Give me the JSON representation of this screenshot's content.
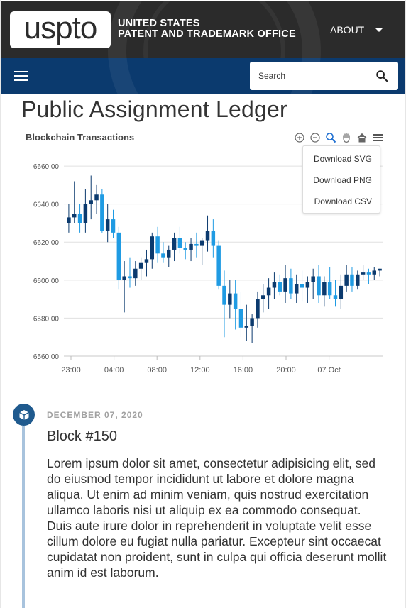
{
  "header": {
    "logo_text": "uspto",
    "agency_line1": "UNITED STATES",
    "agency_line2": "PATENT AND TRADEMARK OFFICE",
    "about_label": "ABOUT"
  },
  "search": {
    "placeholder": "Search"
  },
  "page": {
    "title": "Public Assignment Ledger"
  },
  "chart_menu": {
    "items": [
      "Download SVG",
      "Download PNG",
      "Download CSV"
    ]
  },
  "chart_data": {
    "type": "candlestick",
    "title": "Blockchain Transactions",
    "xlabel": "",
    "ylabel": "",
    "ylim": [
      6560,
      6666
    ],
    "yticks": [
      "6660.00",
      "6640.00",
      "6620.00",
      "6600.00",
      "6580.00",
      "6560.00"
    ],
    "xticks": [
      "23:00",
      "04:00",
      "08:00",
      "12:00",
      "16:00",
      "20:00",
      "07 Oct"
    ],
    "grid": true,
    "colors": {
      "up": "#0b3a6e",
      "down": "#1f9be3",
      "grid": "#e0e0e0",
      "axis": "#555555"
    },
    "candles": [
      [
        6630,
        6640,
        6625,
        6633
      ],
      [
        6633,
        6652,
        6630,
        6635
      ],
      [
        6635,
        6640,
        6625,
        6630
      ],
      [
        6630,
        6648,
        6625,
        6640
      ],
      [
        6640,
        6655,
        6632,
        6642
      ],
      [
        6642,
        6650,
        6635,
        6645
      ],
      [
        6645,
        6648,
        6625,
        6626
      ],
      [
        6626,
        6640,
        6620,
        6632
      ],
      [
        6632,
        6637,
        6622,
        6625
      ],
      [
        6625,
        6628,
        6595,
        6600
      ],
      [
        6600,
        6610,
        6583,
        6602
      ],
      [
        6602,
        6612,
        6596,
        6601
      ],
      [
        6601,
        6610,
        6597,
        6606
      ],
      [
        6606,
        6612,
        6600,
        6609
      ],
      [
        6609,
        6616,
        6602,
        6611
      ],
      [
        6611,
        6625,
        6606,
        6623
      ],
      [
        6623,
        6628,
        6609,
        6614
      ],
      [
        6614,
        6620,
        6609,
        6612
      ],
      [
        6612,
        6618,
        6607,
        6616
      ],
      [
        6616,
        6625,
        6610,
        6622
      ],
      [
        6622,
        6628,
        6614,
        6617
      ],
      [
        6617,
        6620,
        6611,
        6616
      ],
      [
        6616,
        6622,
        6610,
        6619
      ],
      [
        6619,
        6625,
        6612,
        6618
      ],
      [
        6618,
        6622,
        6608,
        6621
      ],
      [
        6621,
        6634,
        6615,
        6626
      ],
      [
        6626,
        6632,
        6612,
        6618
      ],
      [
        6618,
        6621,
        6595,
        6597
      ],
      [
        6597,
        6605,
        6570,
        6587
      ],
      [
        6587,
        6600,
        6580,
        6593
      ],
      [
        6593,
        6600,
        6574,
        6585
      ],
      [
        6585,
        6594,
        6570,
        6575
      ],
      [
        6575,
        6587,
        6568,
        6576
      ],
      [
        6576,
        6582,
        6567,
        6580
      ],
      [
        6580,
        6594,
        6575,
        6590
      ],
      [
        6590,
        6598,
        6583,
        6592
      ],
      [
        6592,
        6601,
        6585,
        6596
      ],
      [
        6596,
        6604,
        6590,
        6599
      ],
      [
        6599,
        6603,
        6592,
        6594
      ],
      [
        6594,
        6608,
        6588,
        6601
      ],
      [
        6601,
        6606,
        6590,
        6593
      ],
      [
        6593,
        6603,
        6588,
        6598
      ],
      [
        6598,
        6605,
        6589,
        6596
      ],
      [
        6596,
        6602,
        6588,
        6599
      ],
      [
        6599,
        6606,
        6590,
        6602
      ],
      [
        6602,
        6608,
        6588,
        6592
      ],
      [
        6592,
        6602,
        6586,
        6599
      ],
      [
        6599,
        6607,
        6590,
        6592
      ],
      [
        6592,
        6600,
        6586,
        6590
      ],
      [
        6590,
        6603,
        6585,
        6597
      ],
      [
        6597,
        6608,
        6594,
        6603
      ],
      [
        6603,
        6607,
        6594,
        6597
      ],
      [
        6597,
        6605,
        6595,
        6603
      ],
      [
        6603,
        6608,
        6600,
        6604
      ],
      [
        6604,
        6606,
        6598,
        6603
      ],
      [
        6603,
        6607,
        6600,
        6605
      ],
      [
        6605,
        6606,
        6602,
        6606
      ]
    ]
  },
  "timeline": {
    "date": "DECEMBER 07, 2020",
    "block": "Block #150",
    "body": "Lorem ipsum dolor sit amet, consectetur adipisicing elit, sed do eiusmod tempor incididunt ut labore et dolore magna aliqua. Ut enim ad minim veniam, quis nostrud exercitation ullamco laboris nisi ut aliquip ex ea commodo consequat. Duis aute irure dolor in reprehenderit in voluptate velit esse cillum dolore eu fugiat nulla pariatur. Excepteur sint occaecat cupidatat non proident, sunt in culpa qui officia deserunt mollit anim id est laborum."
  }
}
